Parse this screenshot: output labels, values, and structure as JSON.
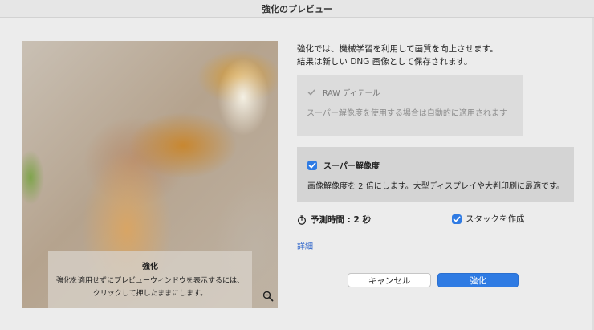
{
  "window": {
    "title": "強化のプレビュー"
  },
  "preview": {
    "tip_title": "強化",
    "tip_line1": "強化を適用せずにプレビューウィンドウを表示するには、",
    "tip_line2": "クリックして押したままにします。",
    "zoom_icon": "zoom-out-icon"
  },
  "description": {
    "line1": "強化では、機械学習を利用して画質を向上させます。",
    "line2": "結果は新しい DNG 画像として保存されます。"
  },
  "raw_details": {
    "label": "RAW ディテール",
    "checked": true,
    "enabled": false,
    "note": "スーパー解像度を使用する場合は自動的に適用されます"
  },
  "super_resolution": {
    "label": "スーパー解像度",
    "checked": true,
    "note": "画像解像度を 2 倍にします。大型ディスプレイや大判印刷に最適です。"
  },
  "estimate": {
    "text": "予測時間 : 2 秒",
    "icon": "stopwatch-icon"
  },
  "stack": {
    "label": "スタックを作成",
    "checked": true
  },
  "details_link": "詳細",
  "buttons": {
    "cancel": "キャンセル",
    "enhance": "強化"
  },
  "colors": {
    "accent": "#2f7be3",
    "panel": "#d4d4d4",
    "background": "#ececec"
  }
}
